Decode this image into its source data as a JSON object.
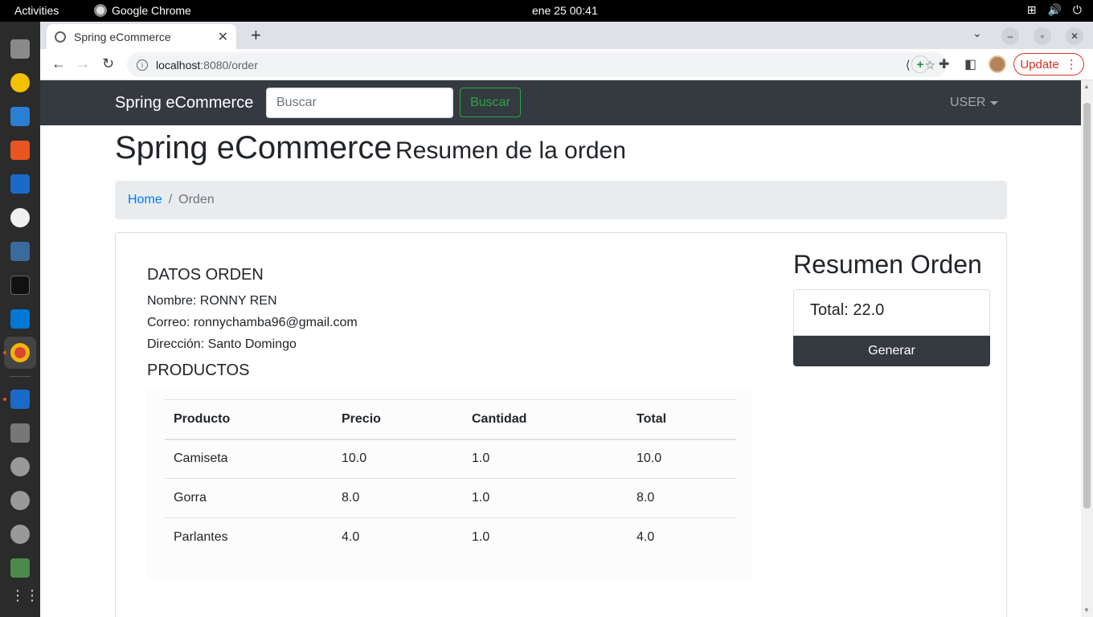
{
  "os": {
    "activities": "Activities",
    "app_name": "Google Chrome",
    "clock": "ene 25  00:41"
  },
  "browser": {
    "tab_title": "Spring eCommerce",
    "url_host": "localhost",
    "url_rest": ":8080/order",
    "update_label": "Update"
  },
  "navbar": {
    "brand": "Spring eCommerce",
    "search_placeholder": "Buscar",
    "search_button": "Buscar",
    "user_menu": "USER"
  },
  "heading": {
    "main": "Spring eCommerce",
    "sub": "Resumen de la orden"
  },
  "breadcrumb": {
    "home": "Home",
    "separator": "/",
    "current": "Orden"
  },
  "order_data": {
    "title": "DATOS ORDEN",
    "name_line": "Nombre: RONNY REN",
    "email_line": "Correo: ronnychamba96@gmail.com",
    "address_line": "Dirección: Santo Domingo"
  },
  "products": {
    "title": "PRODUCTOS",
    "headers": [
      "Producto",
      "Precio",
      "Cantidad",
      "Total"
    ],
    "rows": [
      [
        "Camiseta",
        "10.0",
        "1.0",
        "10.0"
      ],
      [
        "Gorra",
        "8.0",
        "1.0",
        "8.0"
      ],
      [
        "Parlantes",
        "4.0",
        "1.0",
        "4.0"
      ]
    ]
  },
  "summary": {
    "title": "Resumen Orden",
    "total": "Total: 22.0",
    "generate_button": "Generar"
  },
  "colors": {
    "navbar_bg": "#343a40",
    "link": "#007bff",
    "success_outline": "#28a745",
    "update_red": "#d93025"
  }
}
